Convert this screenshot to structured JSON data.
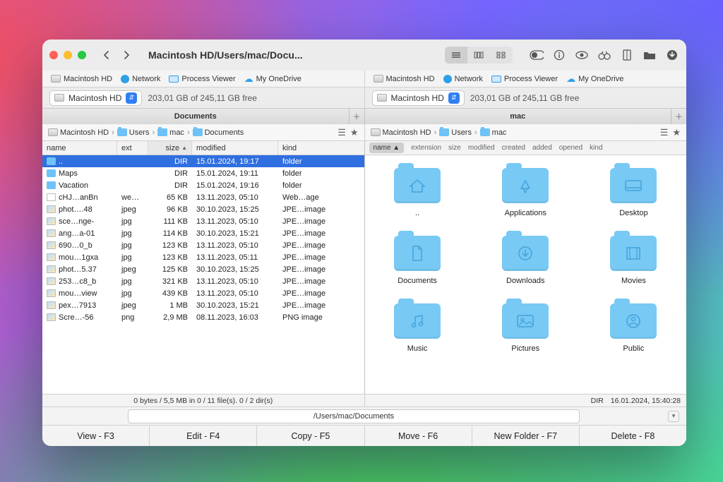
{
  "window": {
    "title_path": "Macintosh HD/Users/mac/Docu..."
  },
  "favorites": [
    {
      "label": "Macintosh HD",
      "icon": "disk"
    },
    {
      "label": "Network",
      "icon": "globe"
    },
    {
      "label": "Process Viewer",
      "icon": "monitor"
    },
    {
      "label": "My OneDrive",
      "icon": "cloud"
    }
  ],
  "drive": {
    "name": "Macintosh HD",
    "free": "203,01 GB of 245,11 GB free"
  },
  "left": {
    "tab_label": "Documents",
    "crumbs": [
      "Macintosh HD",
      "Users",
      "mac",
      "Documents"
    ],
    "columns": {
      "name": "name",
      "ext": "ext",
      "size": "size",
      "modified": "modified",
      "kind": "kind"
    },
    "rows": [
      {
        "sel": true,
        "icon": "folder",
        "name": "..",
        "ext": "",
        "size": "DIR",
        "modified": "15.01.2024, 19:17",
        "kind": "folder"
      },
      {
        "icon": "folder",
        "name": "Maps",
        "ext": "",
        "size": "DIR",
        "modified": "15.01.2024, 19:11",
        "kind": "folder"
      },
      {
        "icon": "folder",
        "name": "Vacation",
        "ext": "",
        "size": "DIR",
        "modified": "15.01.2024, 19:16",
        "kind": "folder"
      },
      {
        "icon": "file",
        "name": "cHJ…anBn",
        "ext": "we…",
        "size": "65 KB",
        "modified": "13.11.2023, 05:10",
        "kind": "Web…age"
      },
      {
        "icon": "img",
        "name": "phot….48",
        "ext": "jpeg",
        "size": "96 KB",
        "modified": "30.10.2023, 15:25",
        "kind": "JPE…image"
      },
      {
        "icon": "img",
        "name": "sce…nge-",
        "ext": "jpg",
        "size": "111 KB",
        "modified": "13.11.2023, 05:10",
        "kind": "JPE…image"
      },
      {
        "icon": "img",
        "name": "ang…a-01",
        "ext": "jpg",
        "size": "114 KB",
        "modified": "30.10.2023, 15:21",
        "kind": "JPE…image"
      },
      {
        "icon": "img",
        "name": "690…0_b",
        "ext": "jpg",
        "size": "123 KB",
        "modified": "13.11.2023, 05:10",
        "kind": "JPE…image"
      },
      {
        "icon": "img",
        "name": "mou…1gxa",
        "ext": "jpg",
        "size": "123 KB",
        "modified": "13.11.2023, 05:11",
        "kind": "JPE…image"
      },
      {
        "icon": "img",
        "name": "phot…5.37",
        "ext": "jpeg",
        "size": "125 KB",
        "modified": "30.10.2023, 15:25",
        "kind": "JPE…image"
      },
      {
        "icon": "img",
        "name": "253…c8_b",
        "ext": "jpg",
        "size": "321 KB",
        "modified": "13.11.2023, 05:10",
        "kind": "JPE…image"
      },
      {
        "icon": "img",
        "name": "mou…view",
        "ext": "jpg",
        "size": "439 KB",
        "modified": "13.11.2023, 05:10",
        "kind": "JPE…image"
      },
      {
        "icon": "img",
        "name": "pex…7913",
        "ext": "jpeg",
        "size": "1 MB",
        "modified": "30.10.2023, 15:21",
        "kind": "JPE…image"
      },
      {
        "icon": "img",
        "name": "Scre…-56",
        "ext": "png",
        "size": "2,9 MB",
        "modified": "08.11.2023, 16:03",
        "kind": "PNG image"
      }
    ],
    "status": "0 bytes / 5,5 MB in 0 / 11 file(s). 0 / 2 dir(s)"
  },
  "right": {
    "tab_label": "mac",
    "crumbs": [
      "Macintosh HD",
      "Users",
      "mac"
    ],
    "header_cols": [
      "name",
      "extension",
      "size",
      "modified",
      "created",
      "added",
      "opened",
      "kind"
    ],
    "active_col": "name",
    "items": [
      {
        "label": "..",
        "glyph": "home"
      },
      {
        "label": "Applications",
        "glyph": "apps"
      },
      {
        "label": "Desktop",
        "glyph": "desktop"
      },
      {
        "label": "Documents",
        "glyph": "doc"
      },
      {
        "label": "Downloads",
        "glyph": "down"
      },
      {
        "label": "Movies",
        "glyph": "movie"
      },
      {
        "label": "Music",
        "glyph": "music"
      },
      {
        "label": "Pictures",
        "glyph": "pic"
      },
      {
        "label": "Public",
        "glyph": "public"
      }
    ],
    "status_dir": "DIR",
    "status_date": "16.01.2024, 15:40:28"
  },
  "path_bar": "/Users/mac/Documents",
  "fn": {
    "view": "View - F3",
    "edit": "Edit - F4",
    "copy": "Copy - F5",
    "move": "Move - F6",
    "newf": "New Folder - F7",
    "del": "Delete - F8"
  }
}
